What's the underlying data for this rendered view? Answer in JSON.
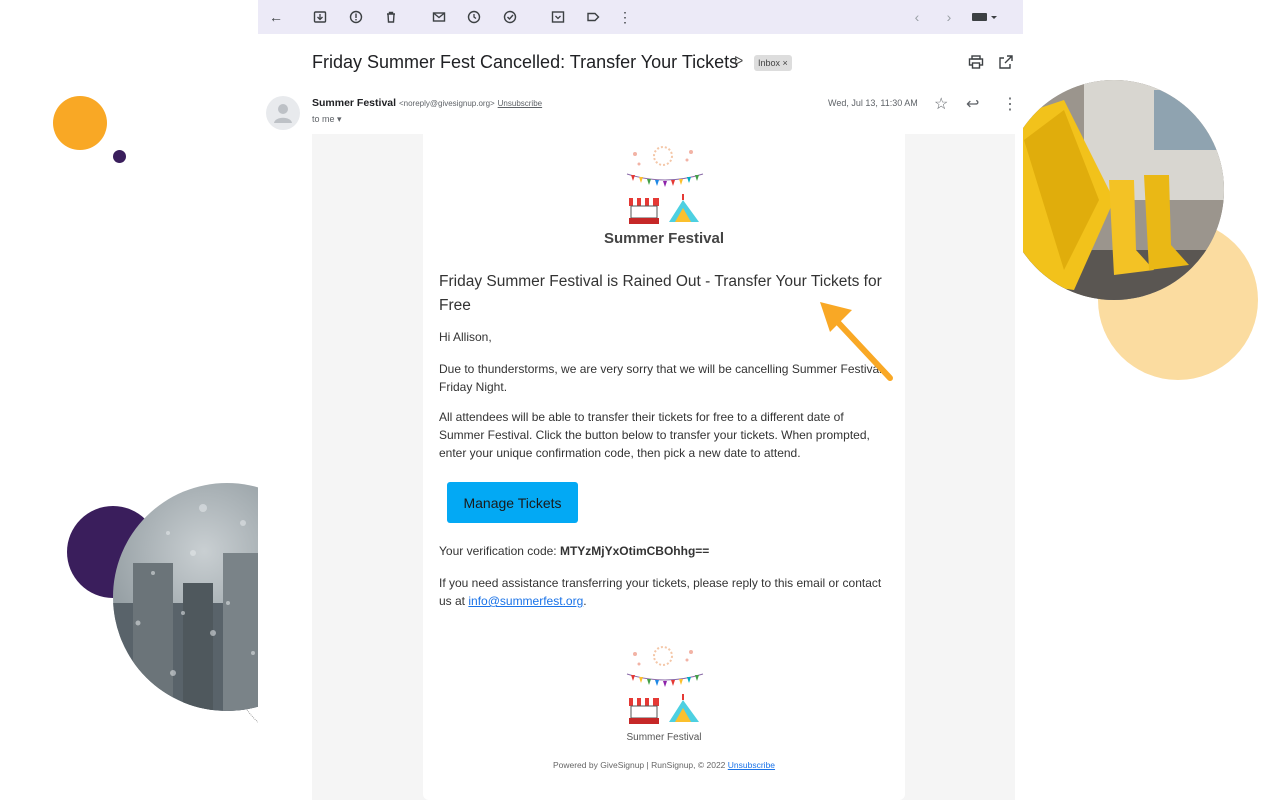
{
  "email": {
    "subject": "Friday Summer Fest Cancelled: Transfer Your Tickets",
    "label_chip": "Inbox ×",
    "sender_name": "Summer Festival",
    "sender_email": "<noreply@givesignup.org>",
    "unsubscribe": "Unsubscribe",
    "to": "to me ▾",
    "date": "Wed, Jul 13, 11:30 AM"
  },
  "content": {
    "brand": "Summer Festival",
    "headline": "Friday Summer Festival is Rained Out - Transfer Your Tickets for Free",
    "greeting": "Hi Allison,",
    "para1": "Due to thunderstorms, we are very sorry that we will be cancelling Summer Festival- Friday Night.",
    "para2": "All attendees will be able to transfer their tickets for free to a different date of Summer Festival. Click the button below to transfer your tickets. When prompted, enter your unique confirmation code, then pick a new date to attend.",
    "button": "Manage Tickets",
    "code_label": "Your verification code: ",
    "code_value": "MTYzMjYxOtimCBOhhg==",
    "para3_prefix": "If you need assistance transferring your tickets, please reply to this email or contact us at ",
    "contact_email": "info@summerfest.org",
    "para3_suffix": ".",
    "footer_brand": "Summer Festival",
    "powered_by": "Powered by GiveSignup | RunSignup, © 2022 ",
    "footer_unsub": "Unsubscribe"
  },
  "icons": {
    "toolbar": [
      "back-icon",
      "archive-icon",
      "report-spam-icon",
      "delete-icon",
      "mark-unread-icon",
      "snooze-icon",
      "add-task-icon",
      "move-to-icon",
      "label-icon",
      "more-icon",
      "prev-icon",
      "next-icon",
      "keyboard-icon"
    ]
  },
  "colors": {
    "accent_button": "#03a9f4",
    "arrow": "#f9a825",
    "toolbar_bg": "#eceaf7",
    "decor_purple": "#3a1e5c",
    "decor_orange": "#f9a825",
    "decor_peach": "#fbdca0"
  }
}
